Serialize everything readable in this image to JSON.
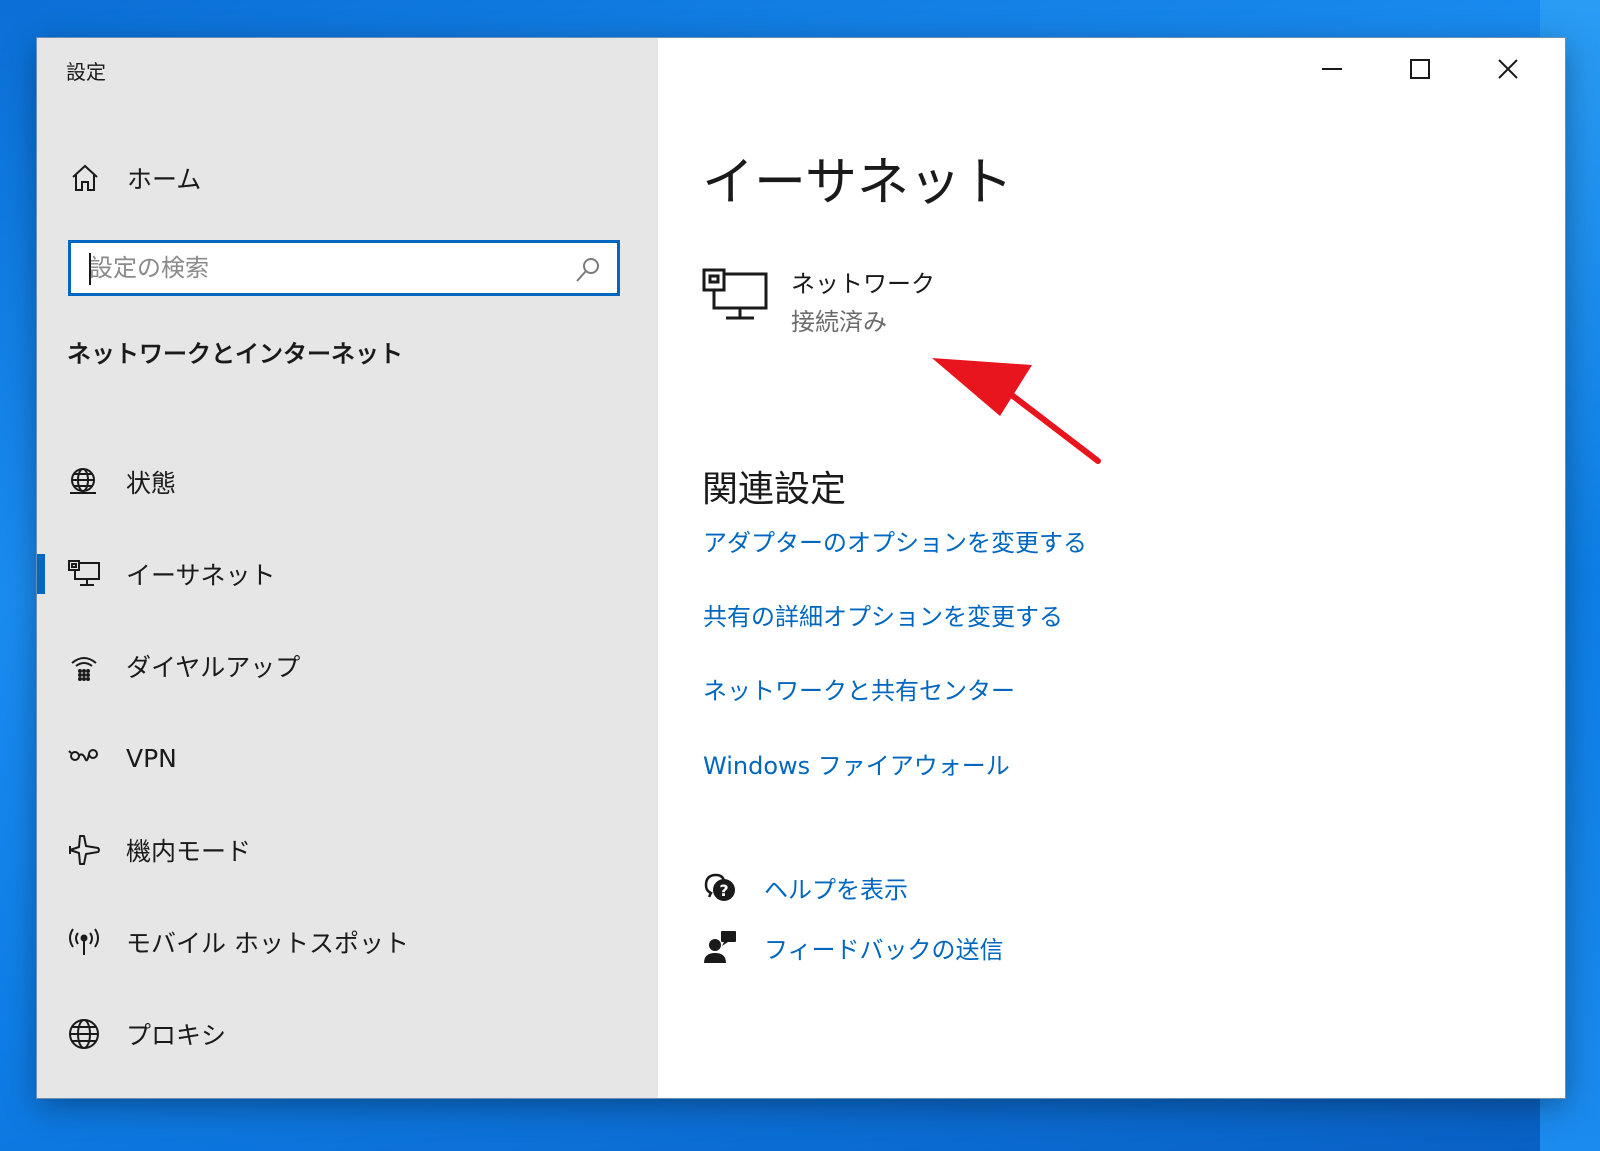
{
  "window": {
    "title": "設定"
  },
  "sidebar": {
    "home_label": "ホーム",
    "search_placeholder": "設定の検索",
    "section_heading": "ネットワークとインターネット",
    "items": [
      {
        "label": "状態",
        "icon": "globe-status-icon"
      },
      {
        "label": "イーサネット",
        "icon": "ethernet-icon",
        "selected": true
      },
      {
        "label": "ダイヤルアップ",
        "icon": "dialup-icon"
      },
      {
        "label": "VPN",
        "icon": "vpn-icon"
      },
      {
        "label": "機内モード",
        "icon": "airplane-icon"
      },
      {
        "label": "モバイル ホットスポット",
        "icon": "hotspot-icon"
      },
      {
        "label": "プロキシ",
        "icon": "globe-icon"
      }
    ]
  },
  "main": {
    "page_title": "イーサネット",
    "network": {
      "name": "ネットワーク",
      "status": "接続済み"
    },
    "related_heading": "関連設定",
    "links": [
      "アダプターのオプションを変更する",
      "共有の詳細オプションを変更する",
      "ネットワークと共有センター",
      "Windows ファイアウォール"
    ],
    "help": {
      "show_help": "ヘルプを表示",
      "send_feedback": "フィードバックの送信"
    }
  },
  "colors": {
    "accent": "#0067c0",
    "sidebar_bg": "#e6e6e6",
    "annotation_arrow": "#e8141e"
  }
}
